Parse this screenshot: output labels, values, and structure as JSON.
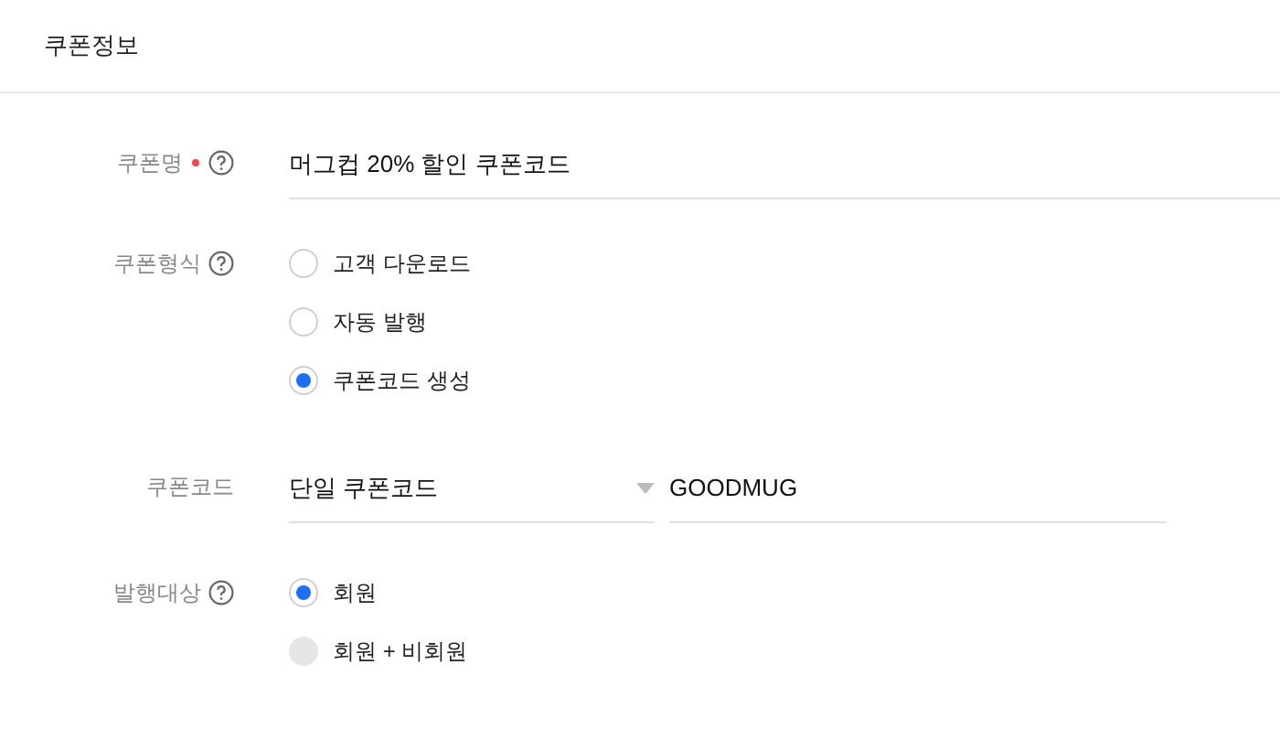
{
  "section_title": "쿠폰정보",
  "rows": [
    {
      "kind": "text",
      "label": "쿠폰명",
      "required": true,
      "help": true,
      "value": "머그컵 20% 할인 쿠폰코드"
    },
    {
      "kind": "radio",
      "label": "쿠폰형식",
      "required": false,
      "help": true,
      "options": [
        {
          "label": "고객 다운로드",
          "selected": false,
          "disabled": false
        },
        {
          "label": "자동 발행",
          "selected": false,
          "disabled": false
        },
        {
          "label": "쿠폰코드 생성",
          "selected": true,
          "disabled": false
        }
      ]
    },
    {
      "kind": "select_text",
      "label": "쿠폰코드",
      "required": false,
      "help": false,
      "select_value": "단일 쿠폰코드",
      "value": "GOODMUG"
    },
    {
      "kind": "radio",
      "label": "발행대상",
      "required": false,
      "help": true,
      "options": [
        {
          "label": "회원",
          "selected": true,
          "disabled": false
        },
        {
          "label": "회원 + 비회원",
          "selected": false,
          "disabled": true
        }
      ]
    }
  ]
}
